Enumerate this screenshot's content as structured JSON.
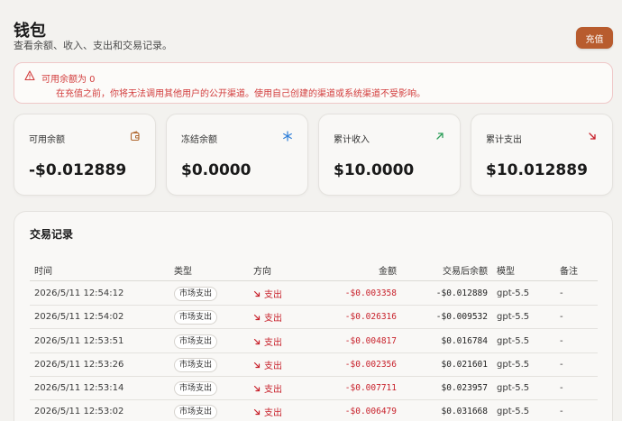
{
  "header": {
    "title": "钱包",
    "subtitle": "查看余额、收入、支出和交易记录。",
    "topup_label": "充值"
  },
  "alert": {
    "title": "可用余额为 0",
    "message": "在充值之前，你将无法调用其他用户的公开渠道。使用自己创建的渠道或系统渠道不受影响。"
  },
  "cards": [
    {
      "label": "可用余额",
      "value": "-$0.012889",
      "icon": "wallet-icon",
      "icon_color": "#b0672f"
    },
    {
      "label": "冻结余额",
      "value": "$0.0000",
      "icon": "snowflake-icon",
      "icon_color": "#2f7fd8"
    },
    {
      "label": "累计收入",
      "value": "$10.0000",
      "icon": "arrow-up-right-icon",
      "icon_color": "#2e9e5a"
    },
    {
      "label": "累计支出",
      "value": "$10.012889",
      "icon": "arrow-down-right-icon",
      "icon_color": "#c8222c"
    }
  ],
  "transactions": {
    "title": "交易记录",
    "columns": {
      "time": "时间",
      "type": "类型",
      "direction": "方向",
      "amount": "金额",
      "balance_after": "交易后余额",
      "model": "模型",
      "note": "备注"
    },
    "rows": [
      {
        "time": "2026/5/11 12:54:12",
        "type": "市场支出",
        "direction": "支出",
        "amount": "-$0.003358",
        "balance_after": "-$0.012889",
        "model": "gpt-5.5",
        "note": "-"
      },
      {
        "time": "2026/5/11 12:54:02",
        "type": "市场支出",
        "direction": "支出",
        "amount": "-$0.026316",
        "balance_after": "-$0.009532",
        "model": "gpt-5.5",
        "note": "-"
      },
      {
        "time": "2026/5/11 12:53:51",
        "type": "市场支出",
        "direction": "支出",
        "amount": "-$0.004817",
        "balance_after": "$0.016784",
        "model": "gpt-5.5",
        "note": "-"
      },
      {
        "time": "2026/5/11 12:53:26",
        "type": "市场支出",
        "direction": "支出",
        "amount": "-$0.002356",
        "balance_after": "$0.021601",
        "model": "gpt-5.5",
        "note": "-"
      },
      {
        "time": "2026/5/11 12:53:14",
        "type": "市场支出",
        "direction": "支出",
        "amount": "-$0.007711",
        "balance_after": "$0.023957",
        "model": "gpt-5.5",
        "note": "-"
      },
      {
        "time": "2026/5/11 12:53:02",
        "type": "市场支出",
        "direction": "支出",
        "amount": "-$0.006479",
        "balance_after": "$0.031668",
        "model": "gpt-5.5",
        "note": "-"
      }
    ]
  },
  "colors": {
    "accent": "#b85c2e",
    "error": "#d23c3c",
    "expense": "#c8222c"
  }
}
